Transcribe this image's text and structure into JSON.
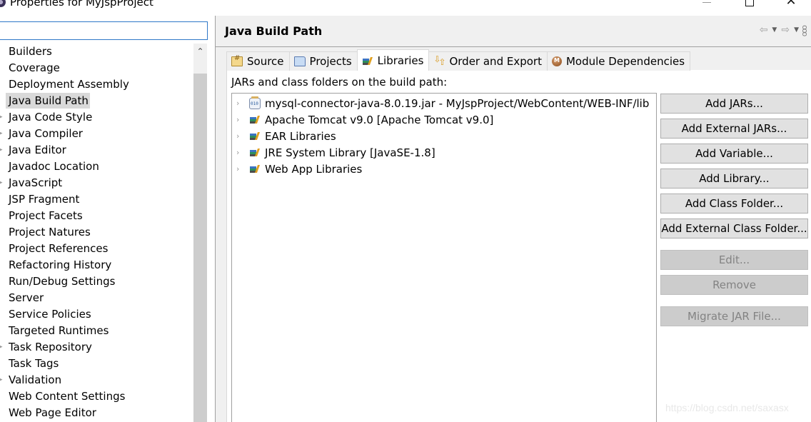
{
  "window": {
    "title": "Properties for MyJspProject",
    "minimize_icon": "minimize-icon",
    "maximize_icon": "maximize-icon",
    "close_glyph": "✕"
  },
  "filter": {
    "value": "",
    "placeholder": ""
  },
  "sidebar": {
    "scroll_up_glyph": "⌃",
    "selected": "Java Build Path",
    "items": [
      {
        "label": "Builders",
        "expandable": false
      },
      {
        "label": "Coverage",
        "expandable": false
      },
      {
        "label": "Deployment Assembly",
        "expandable": false
      },
      {
        "label": "Java Build Path",
        "expandable": false,
        "selected": true
      },
      {
        "label": "Java Code Style",
        "expandable": true
      },
      {
        "label": "Java Compiler",
        "expandable": true
      },
      {
        "label": "Java Editor",
        "expandable": true
      },
      {
        "label": "Javadoc Location",
        "expandable": false
      },
      {
        "label": "JavaScript",
        "expandable": true
      },
      {
        "label": "JSP Fragment",
        "expandable": false
      },
      {
        "label": "Project Facets",
        "expandable": false
      },
      {
        "label": "Project Natures",
        "expandable": false
      },
      {
        "label": "Project References",
        "expandable": false
      },
      {
        "label": "Refactoring History",
        "expandable": false
      },
      {
        "label": "Run/Debug Settings",
        "expandable": false
      },
      {
        "label": "Server",
        "expandable": false
      },
      {
        "label": "Service Policies",
        "expandable": false
      },
      {
        "label": "Targeted Runtimes",
        "expandable": false
      },
      {
        "label": "Task Repository",
        "expandable": true
      },
      {
        "label": "Task Tags",
        "expandable": false
      },
      {
        "label": "Validation",
        "expandable": true
      },
      {
        "label": "Web Content Settings",
        "expandable": false
      },
      {
        "label": "Web Page Editor",
        "expandable": false
      }
    ]
  },
  "page": {
    "title": "Java Build Path",
    "nav": {
      "back_glyph": "⇦",
      "forward_glyph": "⇨",
      "dropdown_glyph": "▼",
      "menu_glyph": "ooo"
    },
    "tabs": [
      {
        "label": "Source",
        "icon": "source-folder-icon"
      },
      {
        "label": "Projects",
        "icon": "project-folder-icon"
      },
      {
        "label": "Libraries",
        "icon": "library-icon",
        "active": true
      },
      {
        "label": "Order and Export",
        "icon": "order-export-icon"
      },
      {
        "label": "Module Dependencies",
        "icon": "module-icon"
      }
    ],
    "libraries_label": "JARs and class folders on the build path:",
    "entries": [
      {
        "label": "mysql-connector-java-8.0.19.jar - MyJspProject/WebContent/WEB-INF/lib",
        "icon": "jar-icon"
      },
      {
        "label": "Apache Tomcat v9.0 [Apache Tomcat v9.0]",
        "icon": "library-icon"
      },
      {
        "label": "EAR Libraries",
        "icon": "library-icon"
      },
      {
        "label": "JRE System Library [JavaSE-1.8]",
        "icon": "library-icon"
      },
      {
        "label": "Web App Libraries",
        "icon": "library-icon"
      }
    ],
    "expander_glyph": "›",
    "buttons": [
      {
        "label": "Add JARs...",
        "enabled": true
      },
      {
        "label": "Add External JARs...",
        "enabled": true
      },
      {
        "label": "Add Variable...",
        "enabled": true
      },
      {
        "label": "Add Library...",
        "enabled": true
      },
      {
        "label": "Add Class Folder...",
        "enabled": true
      },
      {
        "label": "Add External Class Folder...",
        "enabled": true
      },
      {
        "label": "Edit...",
        "enabled": false
      },
      {
        "label": "Remove",
        "enabled": false
      },
      {
        "label": "Migrate JAR File...",
        "enabled": false
      }
    ]
  },
  "watermark": "https://blog.csdn.net/saxasx"
}
